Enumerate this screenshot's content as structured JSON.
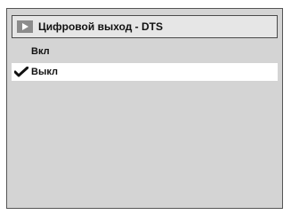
{
  "menu": {
    "title": "Цифровой выход - DTS",
    "title_icon": "play-arrow-icon",
    "options": [
      {
        "label": "Вкл",
        "checked": false,
        "highlighted": false
      },
      {
        "label": "Выкл",
        "checked": true,
        "highlighted": true
      }
    ],
    "check_icon": "checkmark-icon"
  }
}
